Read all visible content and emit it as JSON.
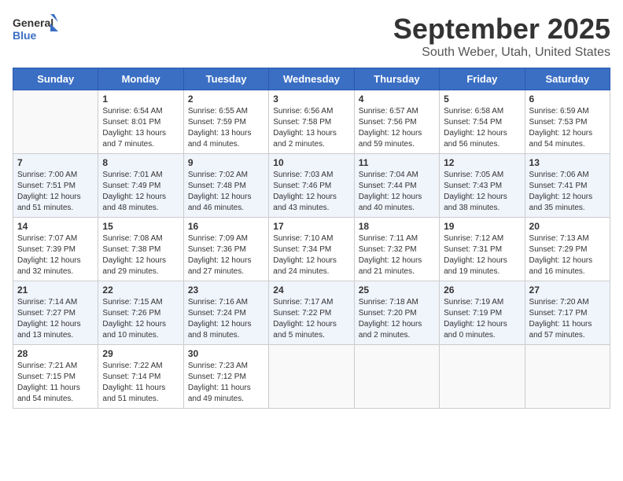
{
  "header": {
    "logo_line1": "General",
    "logo_line2": "Blue",
    "month": "September 2025",
    "location": "South Weber, Utah, United States"
  },
  "weekdays": [
    "Sunday",
    "Monday",
    "Tuesday",
    "Wednesday",
    "Thursday",
    "Friday",
    "Saturday"
  ],
  "weeks": [
    [
      {
        "day": "",
        "sunrise": "",
        "sunset": "",
        "daylight": ""
      },
      {
        "day": "1",
        "sunrise": "Sunrise: 6:54 AM",
        "sunset": "Sunset: 8:01 PM",
        "daylight": "Daylight: 13 hours and 7 minutes."
      },
      {
        "day": "2",
        "sunrise": "Sunrise: 6:55 AM",
        "sunset": "Sunset: 7:59 PM",
        "daylight": "Daylight: 13 hours and 4 minutes."
      },
      {
        "day": "3",
        "sunrise": "Sunrise: 6:56 AM",
        "sunset": "Sunset: 7:58 PM",
        "daylight": "Daylight: 13 hours and 2 minutes."
      },
      {
        "day": "4",
        "sunrise": "Sunrise: 6:57 AM",
        "sunset": "Sunset: 7:56 PM",
        "daylight": "Daylight: 12 hours and 59 minutes."
      },
      {
        "day": "5",
        "sunrise": "Sunrise: 6:58 AM",
        "sunset": "Sunset: 7:54 PM",
        "daylight": "Daylight: 12 hours and 56 minutes."
      },
      {
        "day": "6",
        "sunrise": "Sunrise: 6:59 AM",
        "sunset": "Sunset: 7:53 PM",
        "daylight": "Daylight: 12 hours and 54 minutes."
      }
    ],
    [
      {
        "day": "7",
        "sunrise": "Sunrise: 7:00 AM",
        "sunset": "Sunset: 7:51 PM",
        "daylight": "Daylight: 12 hours and 51 minutes."
      },
      {
        "day": "8",
        "sunrise": "Sunrise: 7:01 AM",
        "sunset": "Sunset: 7:49 PM",
        "daylight": "Daylight: 12 hours and 48 minutes."
      },
      {
        "day": "9",
        "sunrise": "Sunrise: 7:02 AM",
        "sunset": "Sunset: 7:48 PM",
        "daylight": "Daylight: 12 hours and 46 minutes."
      },
      {
        "day": "10",
        "sunrise": "Sunrise: 7:03 AM",
        "sunset": "Sunset: 7:46 PM",
        "daylight": "Daylight: 12 hours and 43 minutes."
      },
      {
        "day": "11",
        "sunrise": "Sunrise: 7:04 AM",
        "sunset": "Sunset: 7:44 PM",
        "daylight": "Daylight: 12 hours and 40 minutes."
      },
      {
        "day": "12",
        "sunrise": "Sunrise: 7:05 AM",
        "sunset": "Sunset: 7:43 PM",
        "daylight": "Daylight: 12 hours and 38 minutes."
      },
      {
        "day": "13",
        "sunrise": "Sunrise: 7:06 AM",
        "sunset": "Sunset: 7:41 PM",
        "daylight": "Daylight: 12 hours and 35 minutes."
      }
    ],
    [
      {
        "day": "14",
        "sunrise": "Sunrise: 7:07 AM",
        "sunset": "Sunset: 7:39 PM",
        "daylight": "Daylight: 12 hours and 32 minutes."
      },
      {
        "day": "15",
        "sunrise": "Sunrise: 7:08 AM",
        "sunset": "Sunset: 7:38 PM",
        "daylight": "Daylight: 12 hours and 29 minutes."
      },
      {
        "day": "16",
        "sunrise": "Sunrise: 7:09 AM",
        "sunset": "Sunset: 7:36 PM",
        "daylight": "Daylight: 12 hours and 27 minutes."
      },
      {
        "day": "17",
        "sunrise": "Sunrise: 7:10 AM",
        "sunset": "Sunset: 7:34 PM",
        "daylight": "Daylight: 12 hours and 24 minutes."
      },
      {
        "day": "18",
        "sunrise": "Sunrise: 7:11 AM",
        "sunset": "Sunset: 7:32 PM",
        "daylight": "Daylight: 12 hours and 21 minutes."
      },
      {
        "day": "19",
        "sunrise": "Sunrise: 7:12 AM",
        "sunset": "Sunset: 7:31 PM",
        "daylight": "Daylight: 12 hours and 19 minutes."
      },
      {
        "day": "20",
        "sunrise": "Sunrise: 7:13 AM",
        "sunset": "Sunset: 7:29 PM",
        "daylight": "Daylight: 12 hours and 16 minutes."
      }
    ],
    [
      {
        "day": "21",
        "sunrise": "Sunrise: 7:14 AM",
        "sunset": "Sunset: 7:27 PM",
        "daylight": "Daylight: 12 hours and 13 minutes."
      },
      {
        "day": "22",
        "sunrise": "Sunrise: 7:15 AM",
        "sunset": "Sunset: 7:26 PM",
        "daylight": "Daylight: 12 hours and 10 minutes."
      },
      {
        "day": "23",
        "sunrise": "Sunrise: 7:16 AM",
        "sunset": "Sunset: 7:24 PM",
        "daylight": "Daylight: 12 hours and 8 minutes."
      },
      {
        "day": "24",
        "sunrise": "Sunrise: 7:17 AM",
        "sunset": "Sunset: 7:22 PM",
        "daylight": "Daylight: 12 hours and 5 minutes."
      },
      {
        "day": "25",
        "sunrise": "Sunrise: 7:18 AM",
        "sunset": "Sunset: 7:20 PM",
        "daylight": "Daylight: 12 hours and 2 minutes."
      },
      {
        "day": "26",
        "sunrise": "Sunrise: 7:19 AM",
        "sunset": "Sunset: 7:19 PM",
        "daylight": "Daylight: 12 hours and 0 minutes."
      },
      {
        "day": "27",
        "sunrise": "Sunrise: 7:20 AM",
        "sunset": "Sunset: 7:17 PM",
        "daylight": "Daylight: 11 hours and 57 minutes."
      }
    ],
    [
      {
        "day": "28",
        "sunrise": "Sunrise: 7:21 AM",
        "sunset": "Sunset: 7:15 PM",
        "daylight": "Daylight: 11 hours and 54 minutes."
      },
      {
        "day": "29",
        "sunrise": "Sunrise: 7:22 AM",
        "sunset": "Sunset: 7:14 PM",
        "daylight": "Daylight: 11 hours and 51 minutes."
      },
      {
        "day": "30",
        "sunrise": "Sunrise: 7:23 AM",
        "sunset": "Sunset: 7:12 PM",
        "daylight": "Daylight: 11 hours and 49 minutes."
      },
      {
        "day": "",
        "sunrise": "",
        "sunset": "",
        "daylight": ""
      },
      {
        "day": "",
        "sunrise": "",
        "sunset": "",
        "daylight": ""
      },
      {
        "day": "",
        "sunrise": "",
        "sunset": "",
        "daylight": ""
      },
      {
        "day": "",
        "sunrise": "",
        "sunset": "",
        "daylight": ""
      }
    ]
  ]
}
